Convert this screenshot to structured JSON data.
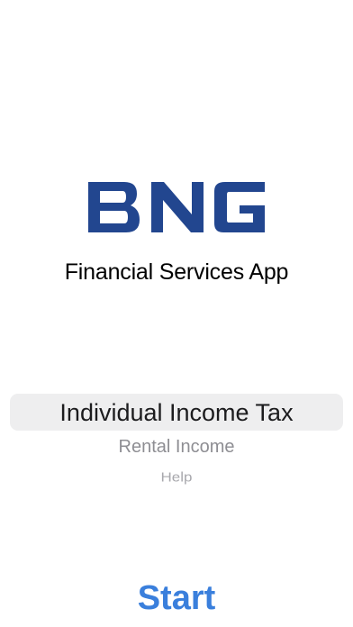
{
  "logo": {
    "text": "BNG",
    "color": "#22468f"
  },
  "app_title": "Financial Services App",
  "picker": {
    "options": [
      "Individual Income Tax",
      "Rental Income",
      "Help"
    ],
    "selected": "Individual Income Tax"
  },
  "start_button": {
    "label": "Start",
    "color": "#3a7fdc"
  }
}
